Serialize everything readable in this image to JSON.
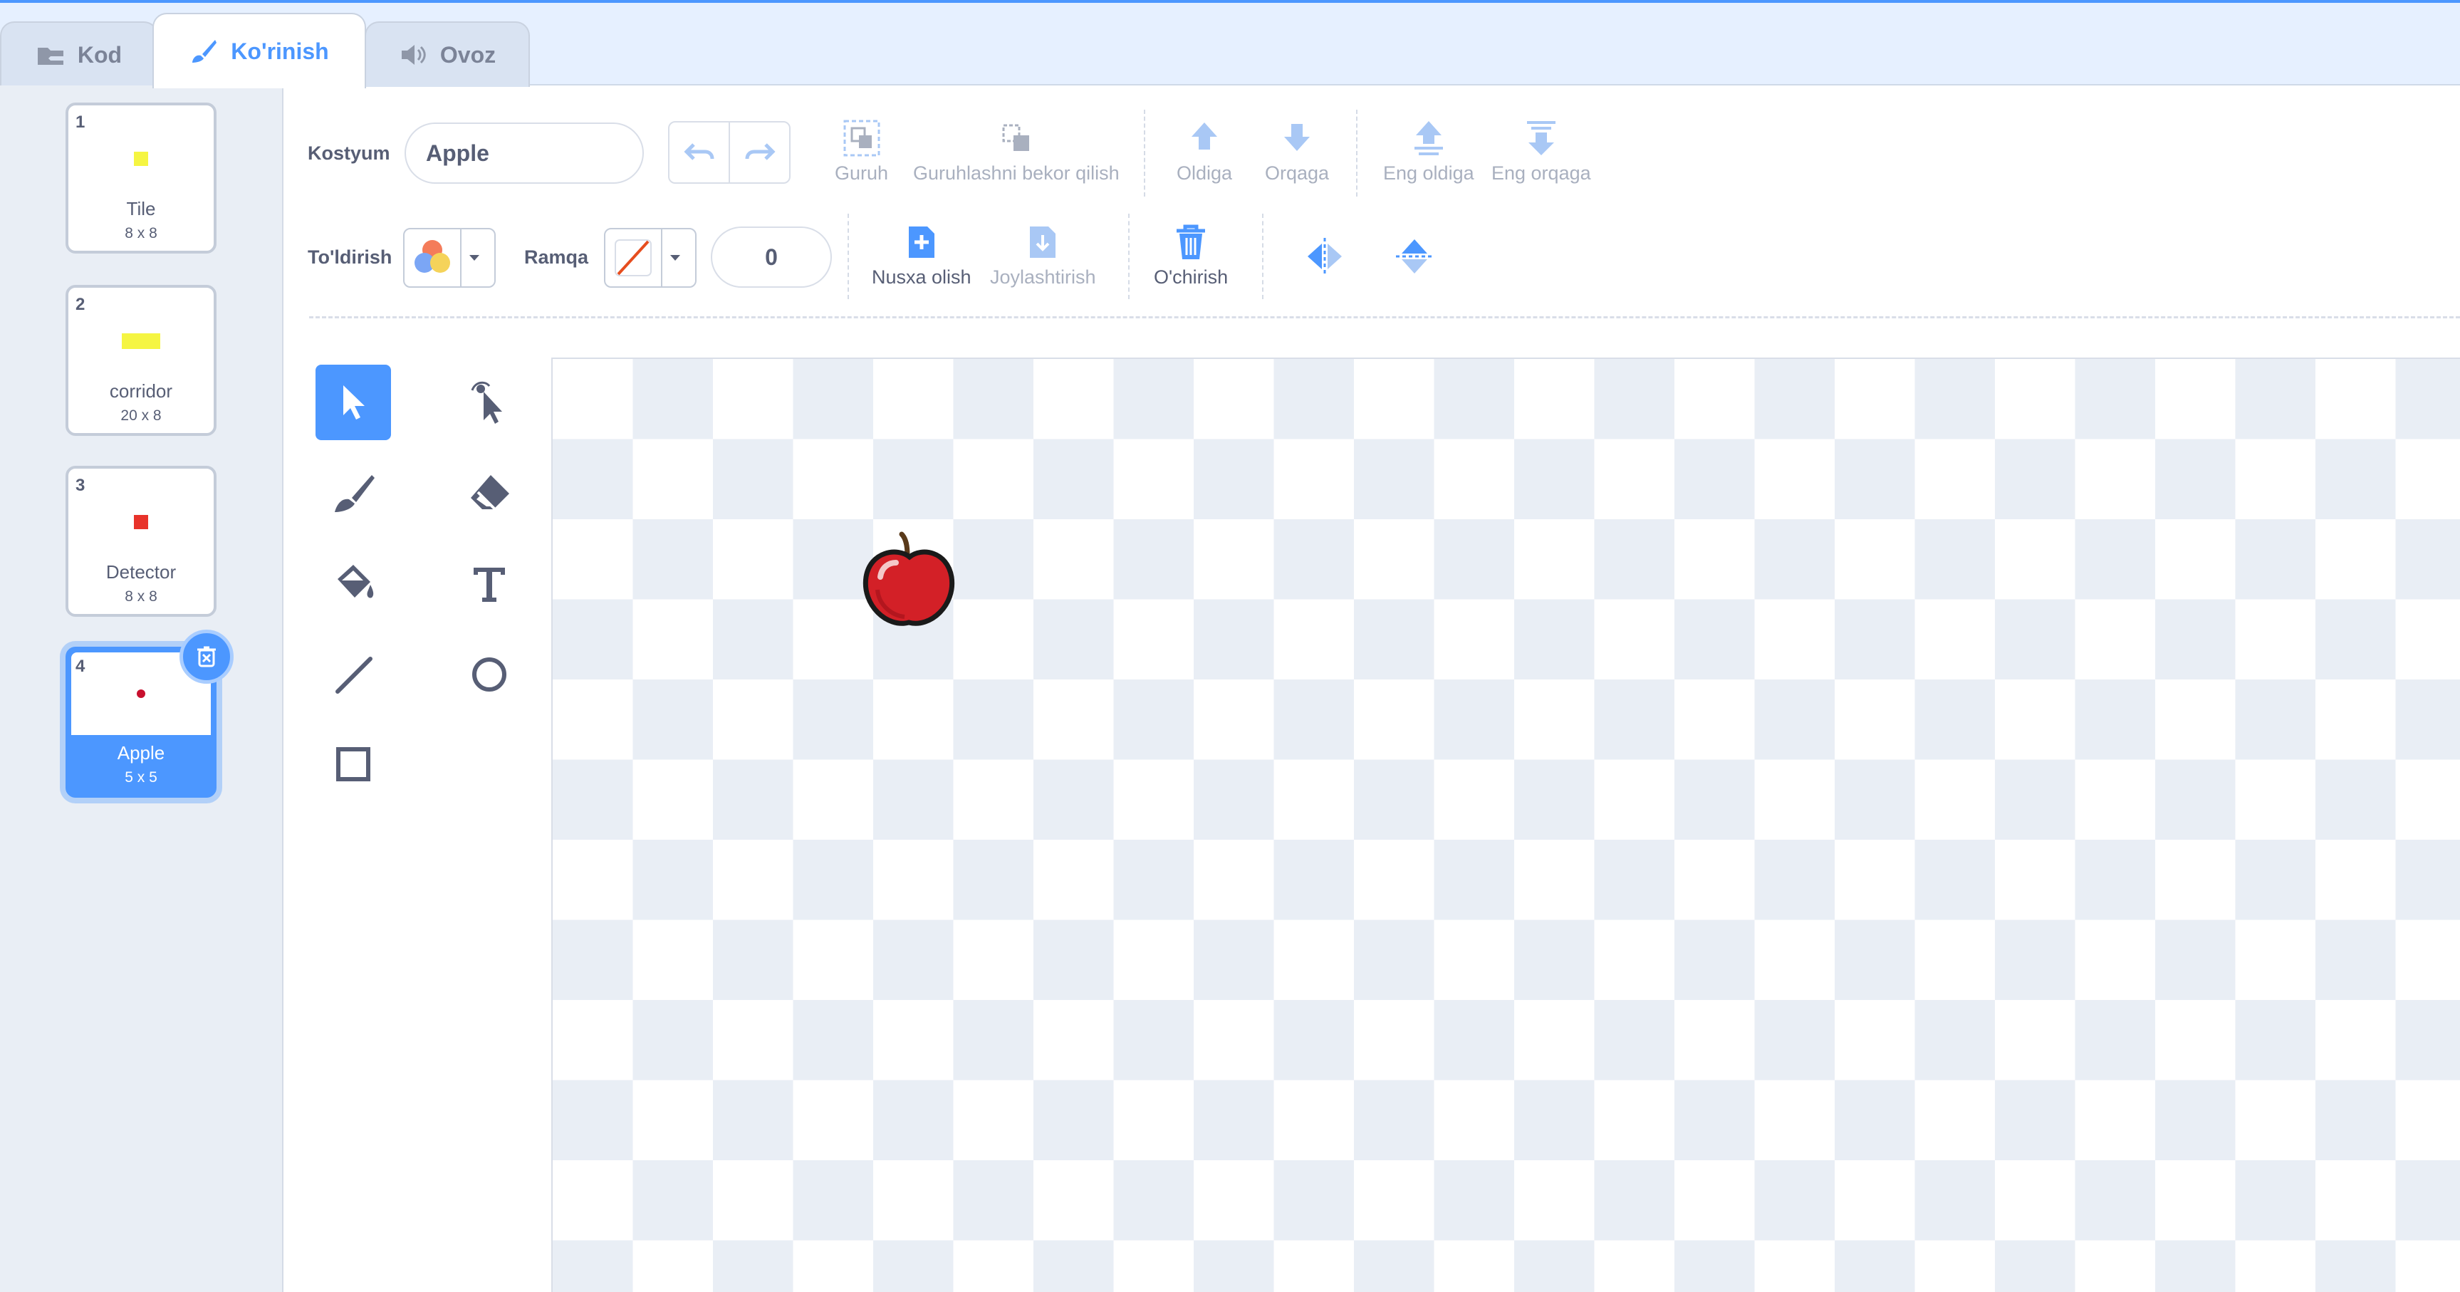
{
  "tabs": [
    {
      "label": "Kod",
      "icon": "code-blocks-icon"
    },
    {
      "label": "Ko'rinish",
      "icon": "paintbrush-icon",
      "active": true
    },
    {
      "label": "Ovoz",
      "icon": "speaker-icon"
    }
  ],
  "costumes": [
    {
      "number": "1",
      "name": "Tile",
      "size": "8 x 8",
      "thumb_color": "#f5f542"
    },
    {
      "number": "2",
      "name": "corridor",
      "size": "20 x 8",
      "thumb_color": "#f5f542"
    },
    {
      "number": "3",
      "name": "Detector",
      "size": "8 x 8",
      "thumb_color": "#e8332a"
    },
    {
      "number": "4",
      "name": "Apple",
      "size": "5 x 5",
      "thumb_color": "#c8102e",
      "selected": true
    }
  ],
  "toolbar": {
    "costume_label": "Kostyum",
    "costume_name": "Apple",
    "group": "Guruh",
    "ungroup": "Guruhlashni bekor qilish",
    "forward": "Oldiga",
    "backward": "Orqaga",
    "front": "Eng oldiga",
    "back": "Eng orqaga",
    "fill_label": "To'ldirish",
    "outline_label": "Ramqa",
    "outline_width": "0",
    "copy": "Nusxa olish",
    "paste": "Joylashtirish",
    "delete": "O'chirish"
  },
  "tools": [
    "select-arrow-icon",
    "reshape-icon",
    "brush-icon",
    "eraser-icon",
    "fill-bucket-icon",
    "text-icon",
    "line-icon",
    "circle-icon",
    "rectangle-icon"
  ],
  "colors": {
    "accent": "#4c97ff",
    "text": "#575e75",
    "muted": "#a9b0bf",
    "apple": "#d32027"
  }
}
